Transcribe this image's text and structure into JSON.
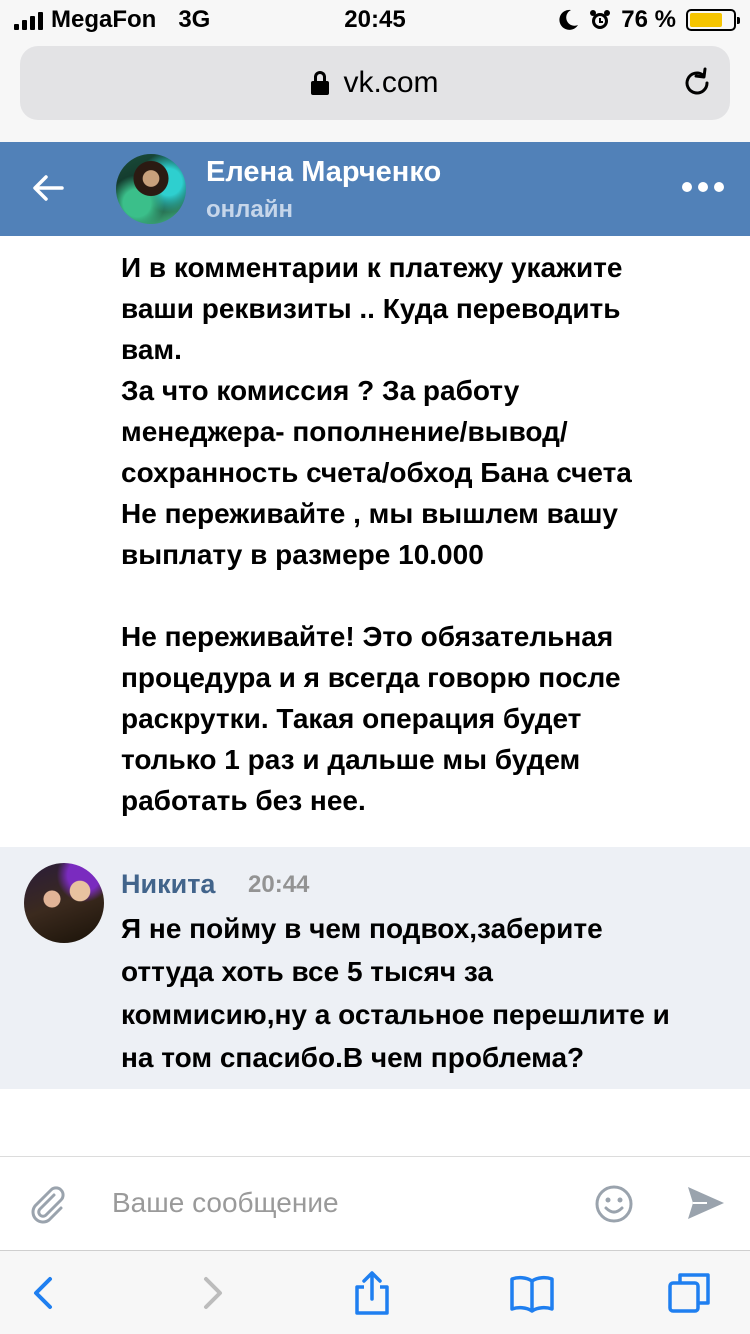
{
  "status_bar": {
    "carrier": "MegaFon",
    "network": "3G",
    "time": "20:45",
    "battery": "76 %"
  },
  "browser": {
    "url": "vk.com"
  },
  "chat_header": {
    "name": "Елена Марченко",
    "status": "онлайн"
  },
  "messages": [
    {
      "text": "И в комментарии к платежу укажите\nваши реквизиты .. Куда переводить\nвам.\nЗа что комиссия ? За работу\nменеджера- пополнение/вывод/\nсохранность счета/обход Бана счета\nНе переживайте , мы вышлем вашу\nвыплату в размере 10.000\n\nНе переживайте! Это обязательная\nпроцедура и я всегда говорю после\nраскрутки. Такая операция будет\nтолько 1 раз и дальше мы будем\nработать без нее."
    },
    {
      "author": "Никита",
      "time": "20:44",
      "text": "Я не пойму в чем подвох,заберите\nоттуда хоть все 5 тысяч за\nкоммисию,ну а остальное перешлите и\nна том спасибо.В чем проблема?"
    }
  ],
  "composer": {
    "placeholder": "Ваше сообщение"
  },
  "colors": {
    "vk_header": "#5181b8",
    "author_name": "#42648b",
    "ios_blue": "#1f7ff0",
    "highlight_bg": "#edf0f5"
  }
}
